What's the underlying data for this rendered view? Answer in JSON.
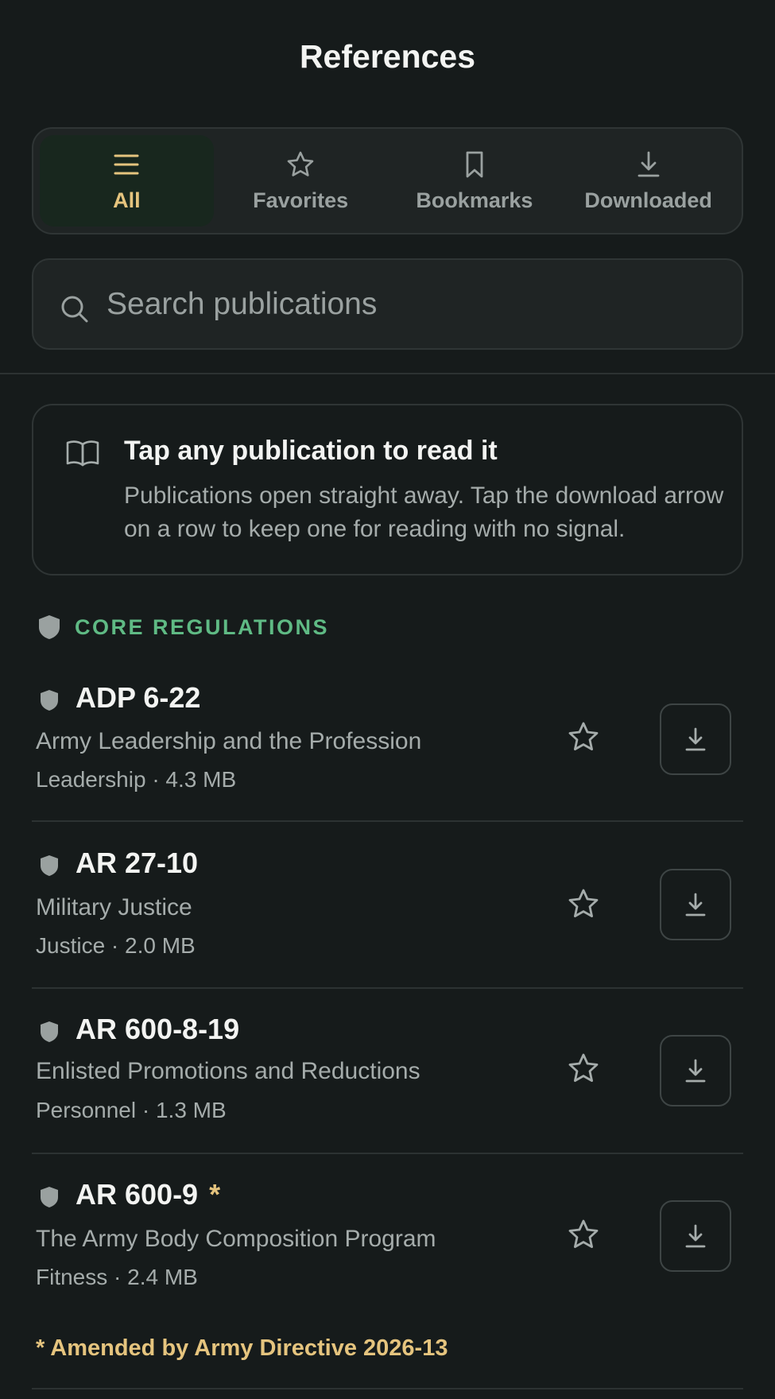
{
  "header": {
    "title": "References"
  },
  "tabs": [
    {
      "label": "All",
      "icon": "menu-icon",
      "active": true
    },
    {
      "label": "Favorites",
      "icon": "star-icon",
      "active": false
    },
    {
      "label": "Bookmarks",
      "icon": "bookmark-icon",
      "active": false
    },
    {
      "label": "Downloaded",
      "icon": "download-icon",
      "active": false
    }
  ],
  "search": {
    "placeholder": "Search publications",
    "value": ""
  },
  "info": {
    "icon": "book-open-icon",
    "heading": "Tap any publication to read it",
    "body": "Publications open straight away. Tap the download arrow on a row to keep one for reading with no signal."
  },
  "section": {
    "icon": "shield-icon",
    "label": "CORE REGULATIONS"
  },
  "publications": [
    {
      "code": "ADP 6-22",
      "amended_mark": "",
      "name": "Army Leadership and the Profession",
      "meta": "Leadership · 4.3 MB"
    },
    {
      "code": "AR 27-10",
      "amended_mark": "",
      "name": "Military Justice",
      "meta": "Justice · 2.0 MB"
    },
    {
      "code": "AR 600-8-19",
      "amended_mark": "",
      "name": "Enlisted Promotions and Reductions",
      "meta": "Personnel · 1.3 MB"
    },
    {
      "code": "AR 600-9",
      "amended_mark": "*",
      "name": "The Army Body Composition Program",
      "meta": "Fitness · 2.4 MB"
    }
  ],
  "footnote": "* Amended by Army Directive 2026-13",
  "colors": {
    "background": "#161b1b",
    "accent_gold": "#e5c47e",
    "accent_green": "#5fba84",
    "muted_text": "#a5acab"
  }
}
